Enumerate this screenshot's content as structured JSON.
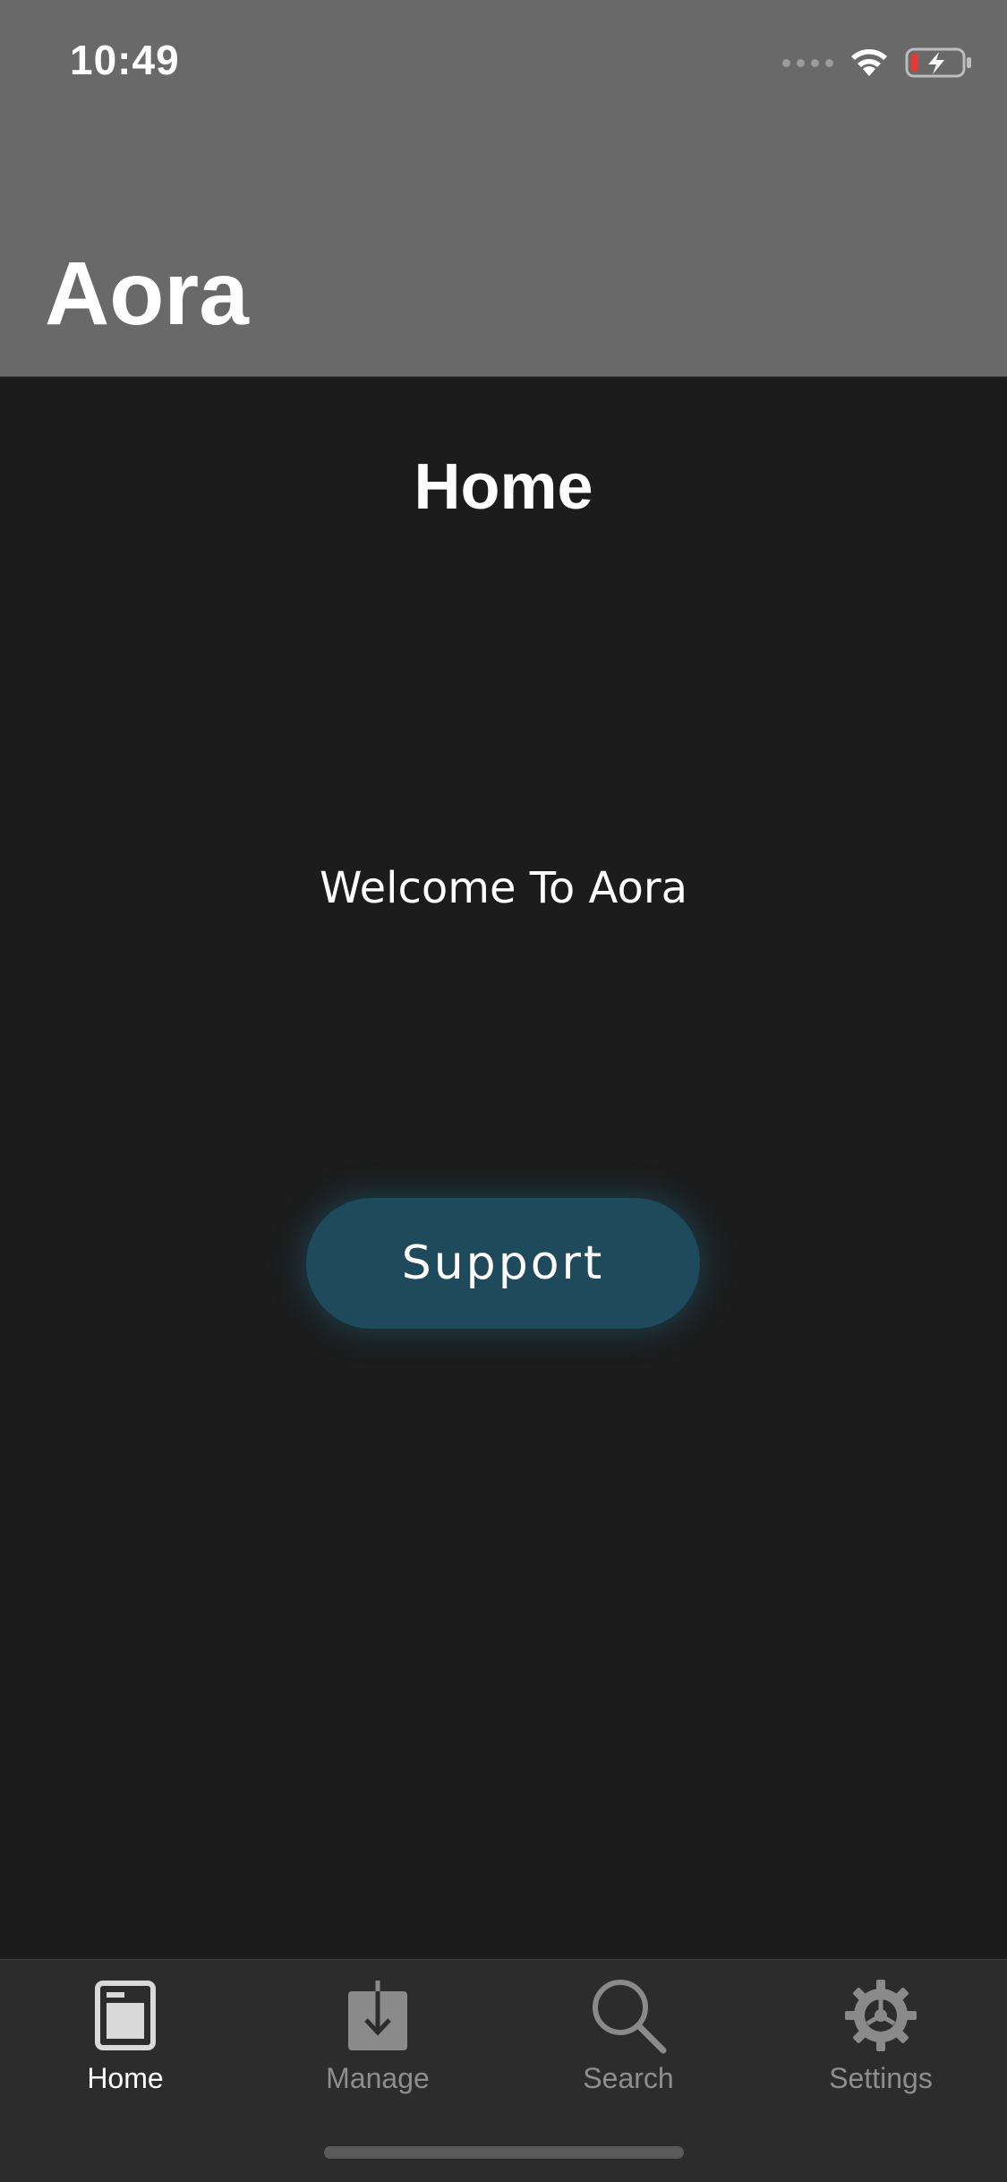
{
  "status_bar": {
    "time": "10:49",
    "icons": [
      "cellular-signal-icon",
      "wifi-icon",
      "battery-charging-icon"
    ]
  },
  "header": {
    "app_title": "Aora"
  },
  "main": {
    "page_title": "Home",
    "welcome_text": "Welcome To Aora",
    "support_button_label": "Support"
  },
  "tab_bar": {
    "tabs": [
      {
        "label": "Home",
        "icon": "home-icon",
        "active": true
      },
      {
        "label": "Manage",
        "icon": "download-icon",
        "active": false
      },
      {
        "label": "Search",
        "icon": "search-icon",
        "active": false
      },
      {
        "label": "Settings",
        "icon": "gear-icon",
        "active": false
      }
    ]
  },
  "colors": {
    "header_bg": "#696969",
    "content_bg": "#1c1c1c",
    "button_bg": "#1e4a5b",
    "tab_bar_bg": "#2c2c2c",
    "tab_active": "#ffffff",
    "tab_inactive": "#8e8e8e",
    "battery_low": "#e53935"
  }
}
